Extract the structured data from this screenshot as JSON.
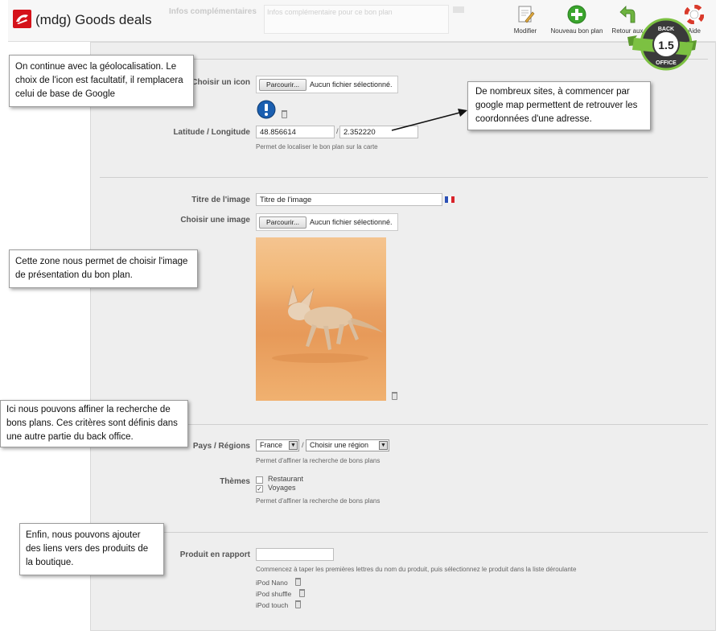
{
  "header": {
    "app_title": "(mdg) Goods deals",
    "ghost_label": "Infos complémentaires",
    "ghost_placeholder": "Infos complémentaire pour ce bon plan",
    "toolbar": [
      {
        "label": "Modifier",
        "icon": "edit-icon"
      },
      {
        "label": "Nouveau bon plan",
        "icon": "add-icon"
      },
      {
        "label": "Retour aux",
        "icon": "back-arrow-icon"
      },
      {
        "label": "Aide",
        "icon": "help-lifebuoy-icon"
      }
    ],
    "badge": {
      "top": "BACK",
      "version": "1.5",
      "bottom": "OFFICE"
    }
  },
  "form": {
    "icon": {
      "label": "Choisir un icon",
      "button": "Parcourir...",
      "file_text": "Aucun fichier sélectionné."
    },
    "geo": {
      "label": "Latitude / Longitude",
      "lat": "48.856614",
      "separator": "/",
      "lng": "2.352220",
      "hint": "Permet de localiser le bon plan sur la carte"
    },
    "image_title": {
      "label": "Titre de l'image",
      "value": "Titre de l'image"
    },
    "image": {
      "label": "Choisir une image",
      "button": "Parcourir...",
      "file_text": "Aucun fichier sélectionné."
    },
    "regions": {
      "label": "Pays / Régions",
      "country": "France",
      "separator": "/",
      "region": "Choisir une région",
      "hint": "Permet d'affiner la recherche de bons plans"
    },
    "themes": {
      "label": "Thèmes",
      "options": [
        {
          "label": "Restaurant",
          "checked": false
        },
        {
          "label": "Voyages",
          "checked": true
        }
      ],
      "hint": "Permet d'affiner la recherche de bons plans"
    },
    "product": {
      "label": "Produit en rapport",
      "value": "",
      "hint": "Commencez à taper les premières lettres du nom du produit, puis sélectionnez le produit dans la liste déroulante",
      "items": [
        "iPod Nano",
        "iPod shuffle",
        "iPod touch"
      ]
    }
  },
  "notes": {
    "geo": "On continue avec la géolocalisation. Le choix de l'icon est facultatif, il remplacera celui de base de Google",
    "sites": "De nombreux sites, à commencer par google map permettent de retrouver les coordonnées d'une adresse.",
    "image": "Cette zone nous permet de choisir l'image de présentation du bon plan.",
    "filters": "Ici nous pouvons affiner la recherche de bons plans. Ces critères sont définis dans une autre partie du back office.",
    "products": "Enfin, nous pouvons ajouter des liens vers des produits de la boutique."
  },
  "colors": {
    "brand_red": "#d5121a",
    "add_green": "#3aa52d",
    "badge_green": "#7cc142",
    "panel_bg": "#eeeeee"
  }
}
